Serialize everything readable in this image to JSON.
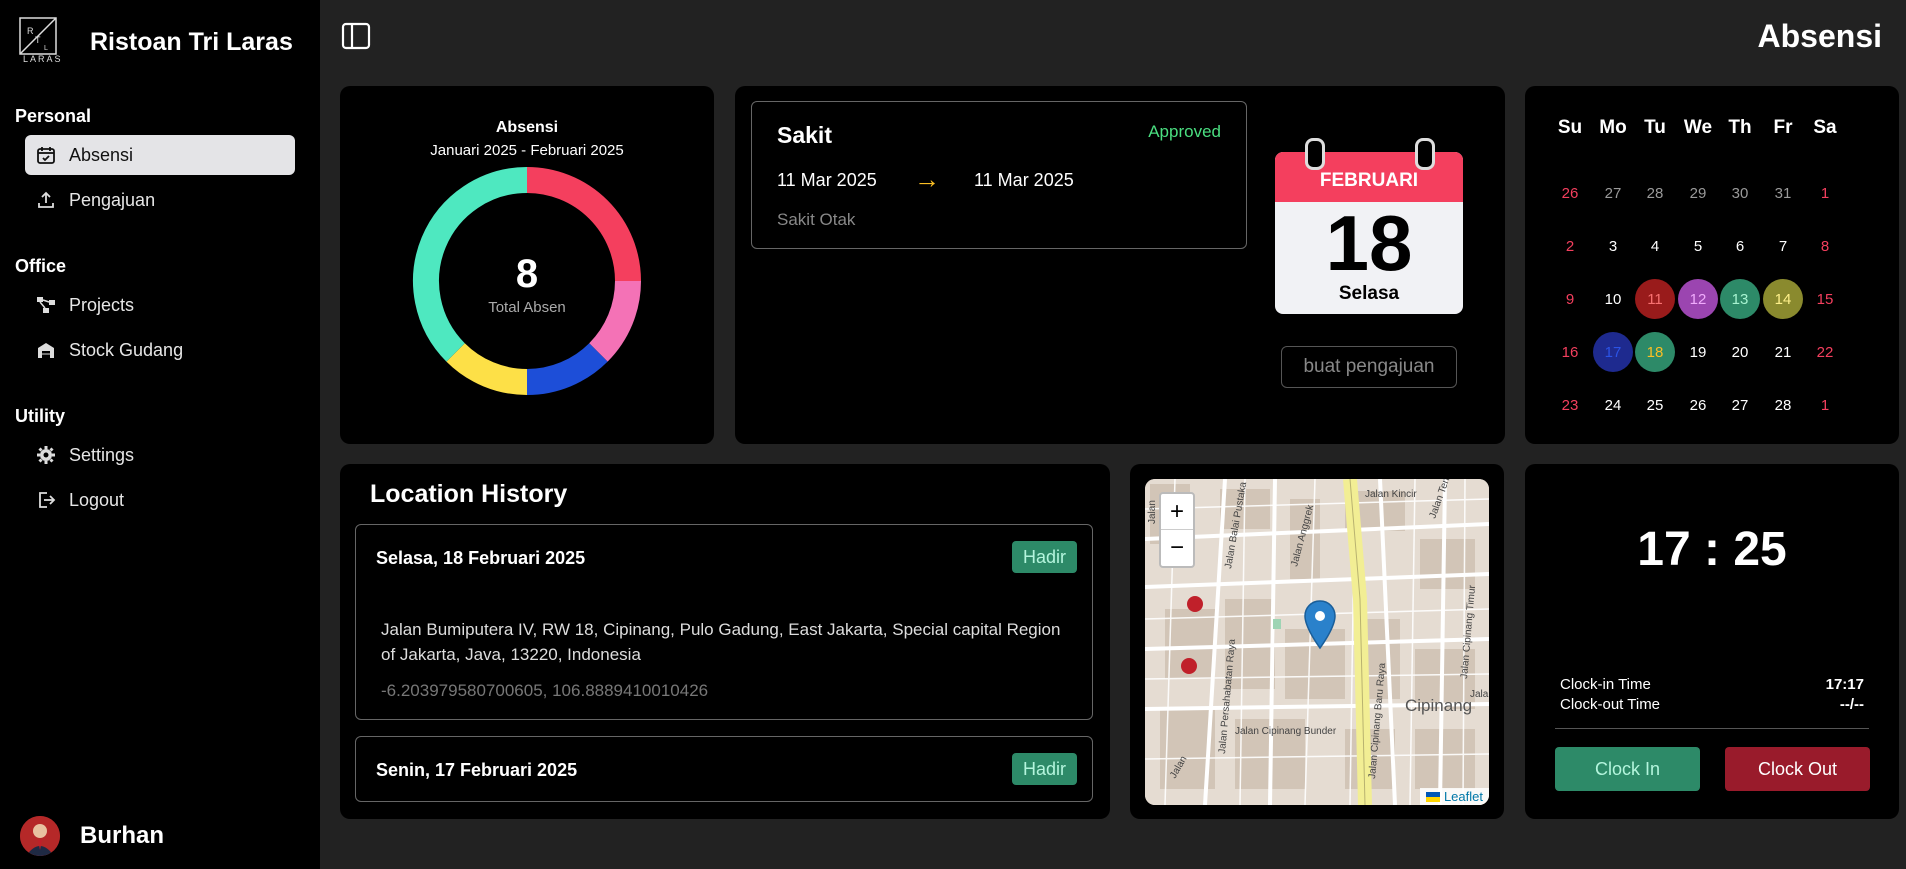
{
  "app": {
    "name": "Ristoan Tri Laras",
    "logo_text": "LARAS"
  },
  "sidebar": {
    "sections": [
      {
        "title": "Personal",
        "items": [
          {
            "label": "Absensi",
            "icon": "calendar-check-icon",
            "active": true
          },
          {
            "label": "Pengajuan",
            "icon": "upload-icon"
          }
        ]
      },
      {
        "title": "Office",
        "items": [
          {
            "label": "Projects",
            "icon": "project-tree-icon"
          },
          {
            "label": "Stock Gudang",
            "icon": "warehouse-icon"
          }
        ]
      },
      {
        "title": "Utility",
        "items": [
          {
            "label": "Settings",
            "icon": "gear-icon"
          },
          {
            "label": "Logout",
            "icon": "logout-icon"
          }
        ]
      }
    ],
    "user": {
      "name": "Burhan"
    }
  },
  "header": {
    "title": "Absensi"
  },
  "attendance_summary": {
    "title": "Absensi",
    "subtitle": "Januari 2025 - Februari 2025",
    "total": "8",
    "total_label": "Total Absen",
    "chart_data": {
      "type": "pie",
      "donut": true,
      "slices": [
        {
          "color": "#f43f5e",
          "value": 2
        },
        {
          "color": "#f472b6",
          "value": 1
        },
        {
          "color": "#1d4ed8",
          "value": 1
        },
        {
          "color": "#fde047",
          "value": 1
        },
        {
          "color": "#4ee8c0",
          "value": 3
        }
      ]
    }
  },
  "request": {
    "type": "Sakit",
    "status": "Approved",
    "date_from": "11 Mar 2025",
    "arrow": "→",
    "date_to": "11 Mar 2025",
    "reason": "Sakit Otak"
  },
  "today": {
    "month": "FEBRUARI",
    "day": "18",
    "weekday": "Selasa"
  },
  "request_button": "buat pengajuan",
  "calendar": {
    "headers": [
      "Su",
      "Mo",
      "Tu",
      "We",
      "Th",
      "Fr",
      "Sa"
    ],
    "weeks": [
      [
        {
          "d": "26",
          "c": "#f43f5e"
        },
        {
          "d": "27",
          "c": "#9a9a9a"
        },
        {
          "d": "28",
          "c": "#9a9a9a"
        },
        {
          "d": "29",
          "c": "#9a9a9a"
        },
        {
          "d": "30",
          "c": "#9a9a9a"
        },
        {
          "d": "31",
          "c": "#9a9a9a"
        },
        {
          "d": "1",
          "c": "#f43f5e"
        }
      ],
      [
        {
          "d": "2",
          "c": "#f43f5e"
        },
        {
          "d": "3",
          "c": "#ffffff"
        },
        {
          "d": "4",
          "c": "#ffffff"
        },
        {
          "d": "5",
          "c": "#ffffff"
        },
        {
          "d": "6",
          "c": "#ffffff"
        },
        {
          "d": "7",
          "c": "#ffffff"
        },
        {
          "d": "8",
          "c": "#f43f5e"
        }
      ],
      [
        {
          "d": "9",
          "c": "#f43f5e"
        },
        {
          "d": "10",
          "c": "#ffffff"
        },
        {
          "d": "11",
          "c": "#f87171",
          "bg": "#991b1b"
        },
        {
          "d": "12",
          "c": "#f0abfc",
          "bg": "#9b45b0"
        },
        {
          "d": "13",
          "c": "#a7f3d0",
          "bg": "#2d8a68"
        },
        {
          "d": "14",
          "c": "#fef08a",
          "bg": "#8a8a2e"
        },
        {
          "d": "15",
          "c": "#f43f5e"
        }
      ],
      [
        {
          "d": "16",
          "c": "#f43f5e"
        },
        {
          "d": "17",
          "c": "#2b53e6",
          "bg": "#1e2a8f"
        },
        {
          "d": "18",
          "c": "#fbbf24",
          "bg": "#2d8a68"
        },
        {
          "d": "19",
          "c": "#ffffff"
        },
        {
          "d": "20",
          "c": "#ffffff"
        },
        {
          "d": "21",
          "c": "#ffffff"
        },
        {
          "d": "22",
          "c": "#f43f5e"
        }
      ],
      [
        {
          "d": "23",
          "c": "#f43f5e"
        },
        {
          "d": "24",
          "c": "#ffffff"
        },
        {
          "d": "25",
          "c": "#ffffff"
        },
        {
          "d": "26",
          "c": "#ffffff"
        },
        {
          "d": "27",
          "c": "#ffffff"
        },
        {
          "d": "28",
          "c": "#ffffff"
        },
        {
          "d": "1",
          "c": "#f43f5e"
        }
      ]
    ]
  },
  "location_history": {
    "title": "Location History",
    "items": [
      {
        "date": "Selasa, 18 Februari 2025",
        "status": "Hadir",
        "address": "Jalan Bumiputera IV, RW 18, Cipinang, Pulo Gadung, East Jakarta, Special capital Region of Jakarta, Java, 13220, Indonesia",
        "coords": "-6.203979580700605, 106.8889410010426"
      },
      {
        "date": "Senin, 17 Februari 2025",
        "status": "Hadir"
      }
    ]
  },
  "map": {
    "zoom_in": "+",
    "zoom_out": "−",
    "attribution": "Leaflet",
    "labels": [
      "Jalan Kincir",
      "Jalan Balai Pustaka",
      "Jalan Anggrek",
      "Jalan Tenggiri",
      "Jalan Persahabatan Raya",
      "Jalan Cipinang Baru Raya",
      "Jalan Cipinang Timur",
      "Jalan Cipinang Bunder",
      "Cipinang",
      "Jalan",
      "Jalan",
      "Jalan"
    ]
  },
  "clock": {
    "time": "17 : 25",
    "clock_in_label": "Clock-in Time",
    "clock_in_value": "17:17",
    "clock_out_label": "Clock-out Time",
    "clock_out_value": "--/--",
    "clock_in_button": "Clock In",
    "clock_out_button": "Clock Out"
  }
}
